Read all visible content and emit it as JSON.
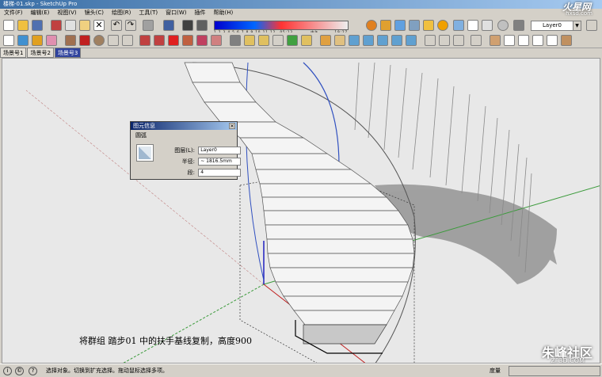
{
  "window": {
    "title": "楼梯-01.skp - SketchUp Pro"
  },
  "menu": [
    "文件(F)",
    "编辑(E)",
    "视图(V)",
    "镜头(C)",
    "绘图(R)",
    "工具(T)",
    "窗口(W)",
    "插件",
    "帮助(H)"
  ],
  "toolbar": {
    "shadow_scale": "1 2 3 4 5 6 7 8 9 10 11 12",
    "shadow_time": "05:13",
    "shadow_noon": "中午",
    "shadow_end": "19:27",
    "layer_value": "Layer0"
  },
  "tabs": [
    "场景号1",
    "场景号2",
    "场景号3"
  ],
  "entity_info": {
    "title": "图元信息",
    "type": "圆弧",
    "layer_label": "图层(L):",
    "layer_value": "Layer0",
    "radius_label": "半径:",
    "radius_value": "~ 1816.5mm",
    "segments_label": "段:",
    "segments_value": "4"
  },
  "caption": "将群组 踏步01 中的扶手基线复制，高度900",
  "brand_top": "火星网",
  "brand_top_sub": "hxsd.com",
  "brand_bottom": "朱峰社区",
  "brand_bottom_sub": "ZF3D.COM",
  "status": {
    "text": "选择对象。切换到扩充选择。拖动鼠标选择多项。",
    "measure_label": "度量"
  }
}
